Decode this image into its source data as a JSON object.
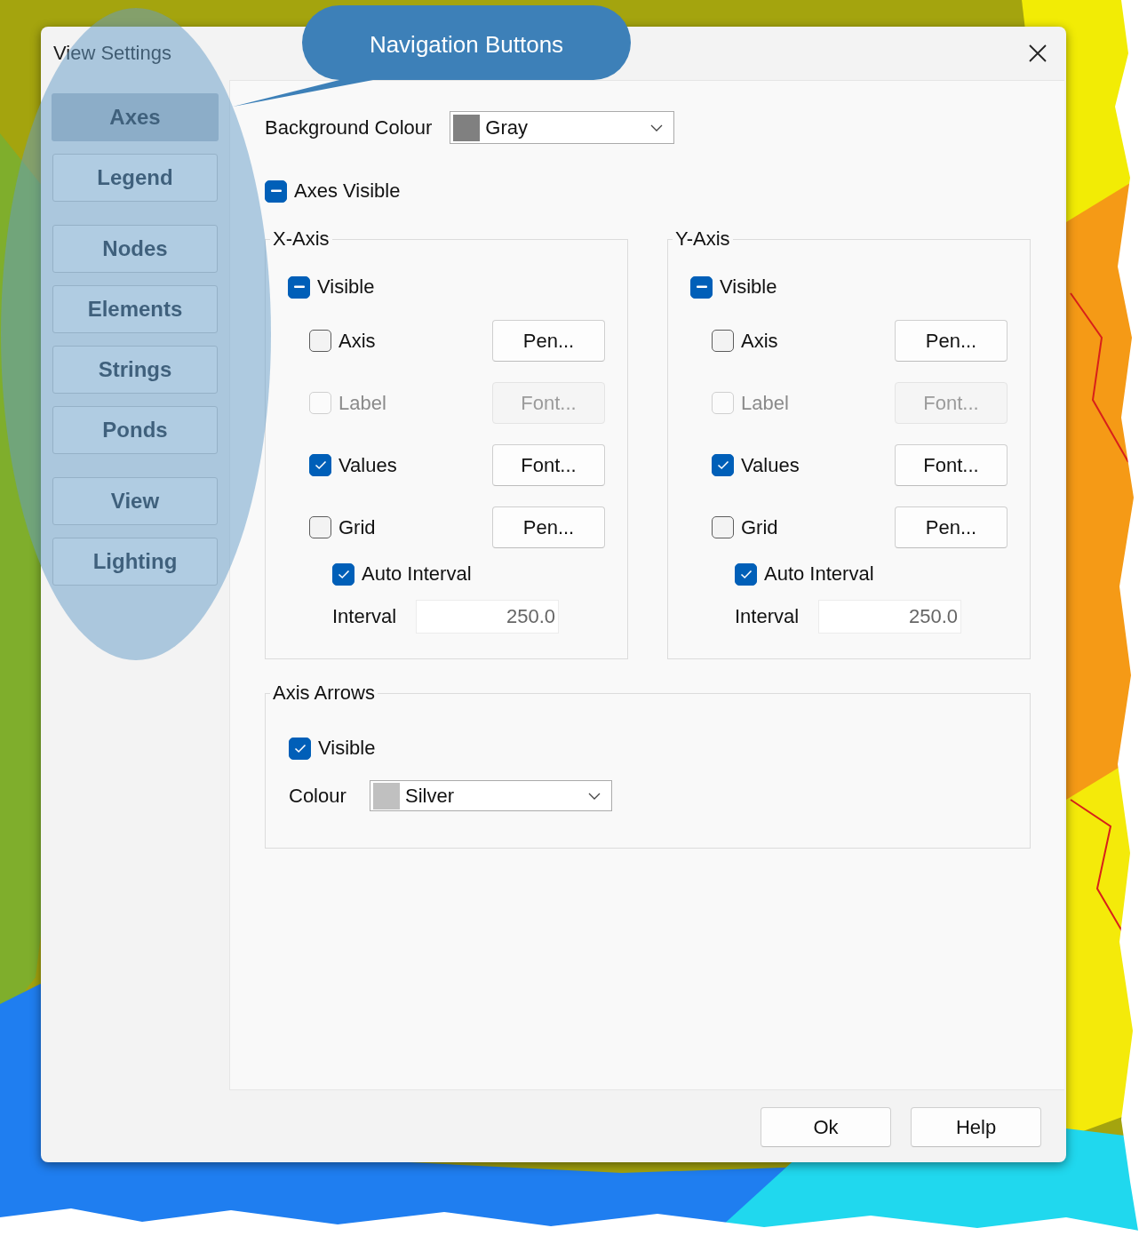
{
  "window": {
    "title": "View Settings"
  },
  "callout": {
    "text": "Navigation Buttons"
  },
  "sidebar": {
    "groups": [
      {
        "items": [
          {
            "label": "Axes",
            "selected": true
          },
          {
            "label": "Legend",
            "selected": false
          }
        ]
      },
      {
        "items": [
          {
            "label": "Nodes",
            "selected": false
          },
          {
            "label": "Elements",
            "selected": false
          },
          {
            "label": "Strings",
            "selected": false
          },
          {
            "label": "Ponds",
            "selected": false
          }
        ]
      },
      {
        "items": [
          {
            "label": "View",
            "selected": false
          },
          {
            "label": "Lighting",
            "selected": false
          }
        ]
      }
    ]
  },
  "background_colour": {
    "label": "Background Colour",
    "value": "Gray",
    "color": "#808080"
  },
  "axes_visible": {
    "label": "Axes Visible",
    "indeterminate": true
  },
  "axis_groups": [
    {
      "title": "X-Axis",
      "visible": {
        "label": "Visible",
        "indeterminate": true
      },
      "rows": [
        {
          "label": "Axis",
          "checked": false,
          "disabled": false,
          "button": "Pen..."
        },
        {
          "label": "Label",
          "checked": false,
          "disabled": true,
          "button": "Font..."
        },
        {
          "label": "Values",
          "checked": true,
          "disabled": false,
          "button": "Font..."
        },
        {
          "label": "Grid",
          "checked": false,
          "disabled": false,
          "button": "Pen..."
        }
      ],
      "auto_interval": {
        "label": "Auto Interval",
        "checked": true
      },
      "interval": {
        "label": "Interval",
        "value": "250.0"
      }
    },
    {
      "title": "Y-Axis",
      "visible": {
        "label": "Visible",
        "indeterminate": true
      },
      "rows": [
        {
          "label": "Axis",
          "checked": false,
          "disabled": false,
          "button": "Pen..."
        },
        {
          "label": "Label",
          "checked": false,
          "disabled": true,
          "button": "Font..."
        },
        {
          "label": "Values",
          "checked": true,
          "disabled": false,
          "button": "Font..."
        },
        {
          "label": "Grid",
          "checked": false,
          "disabled": false,
          "button": "Pen..."
        }
      ],
      "auto_interval": {
        "label": "Auto Interval",
        "checked": true
      },
      "interval": {
        "label": "Interval",
        "value": "250.0"
      }
    }
  ],
  "axis_arrows": {
    "title": "Axis Arrows",
    "visible": {
      "label": "Visible",
      "checked": true
    },
    "colour": {
      "label": "Colour",
      "value": "Silver",
      "color": "#c0c0c0"
    }
  },
  "buttons": [
    "Ok",
    "Help"
  ]
}
